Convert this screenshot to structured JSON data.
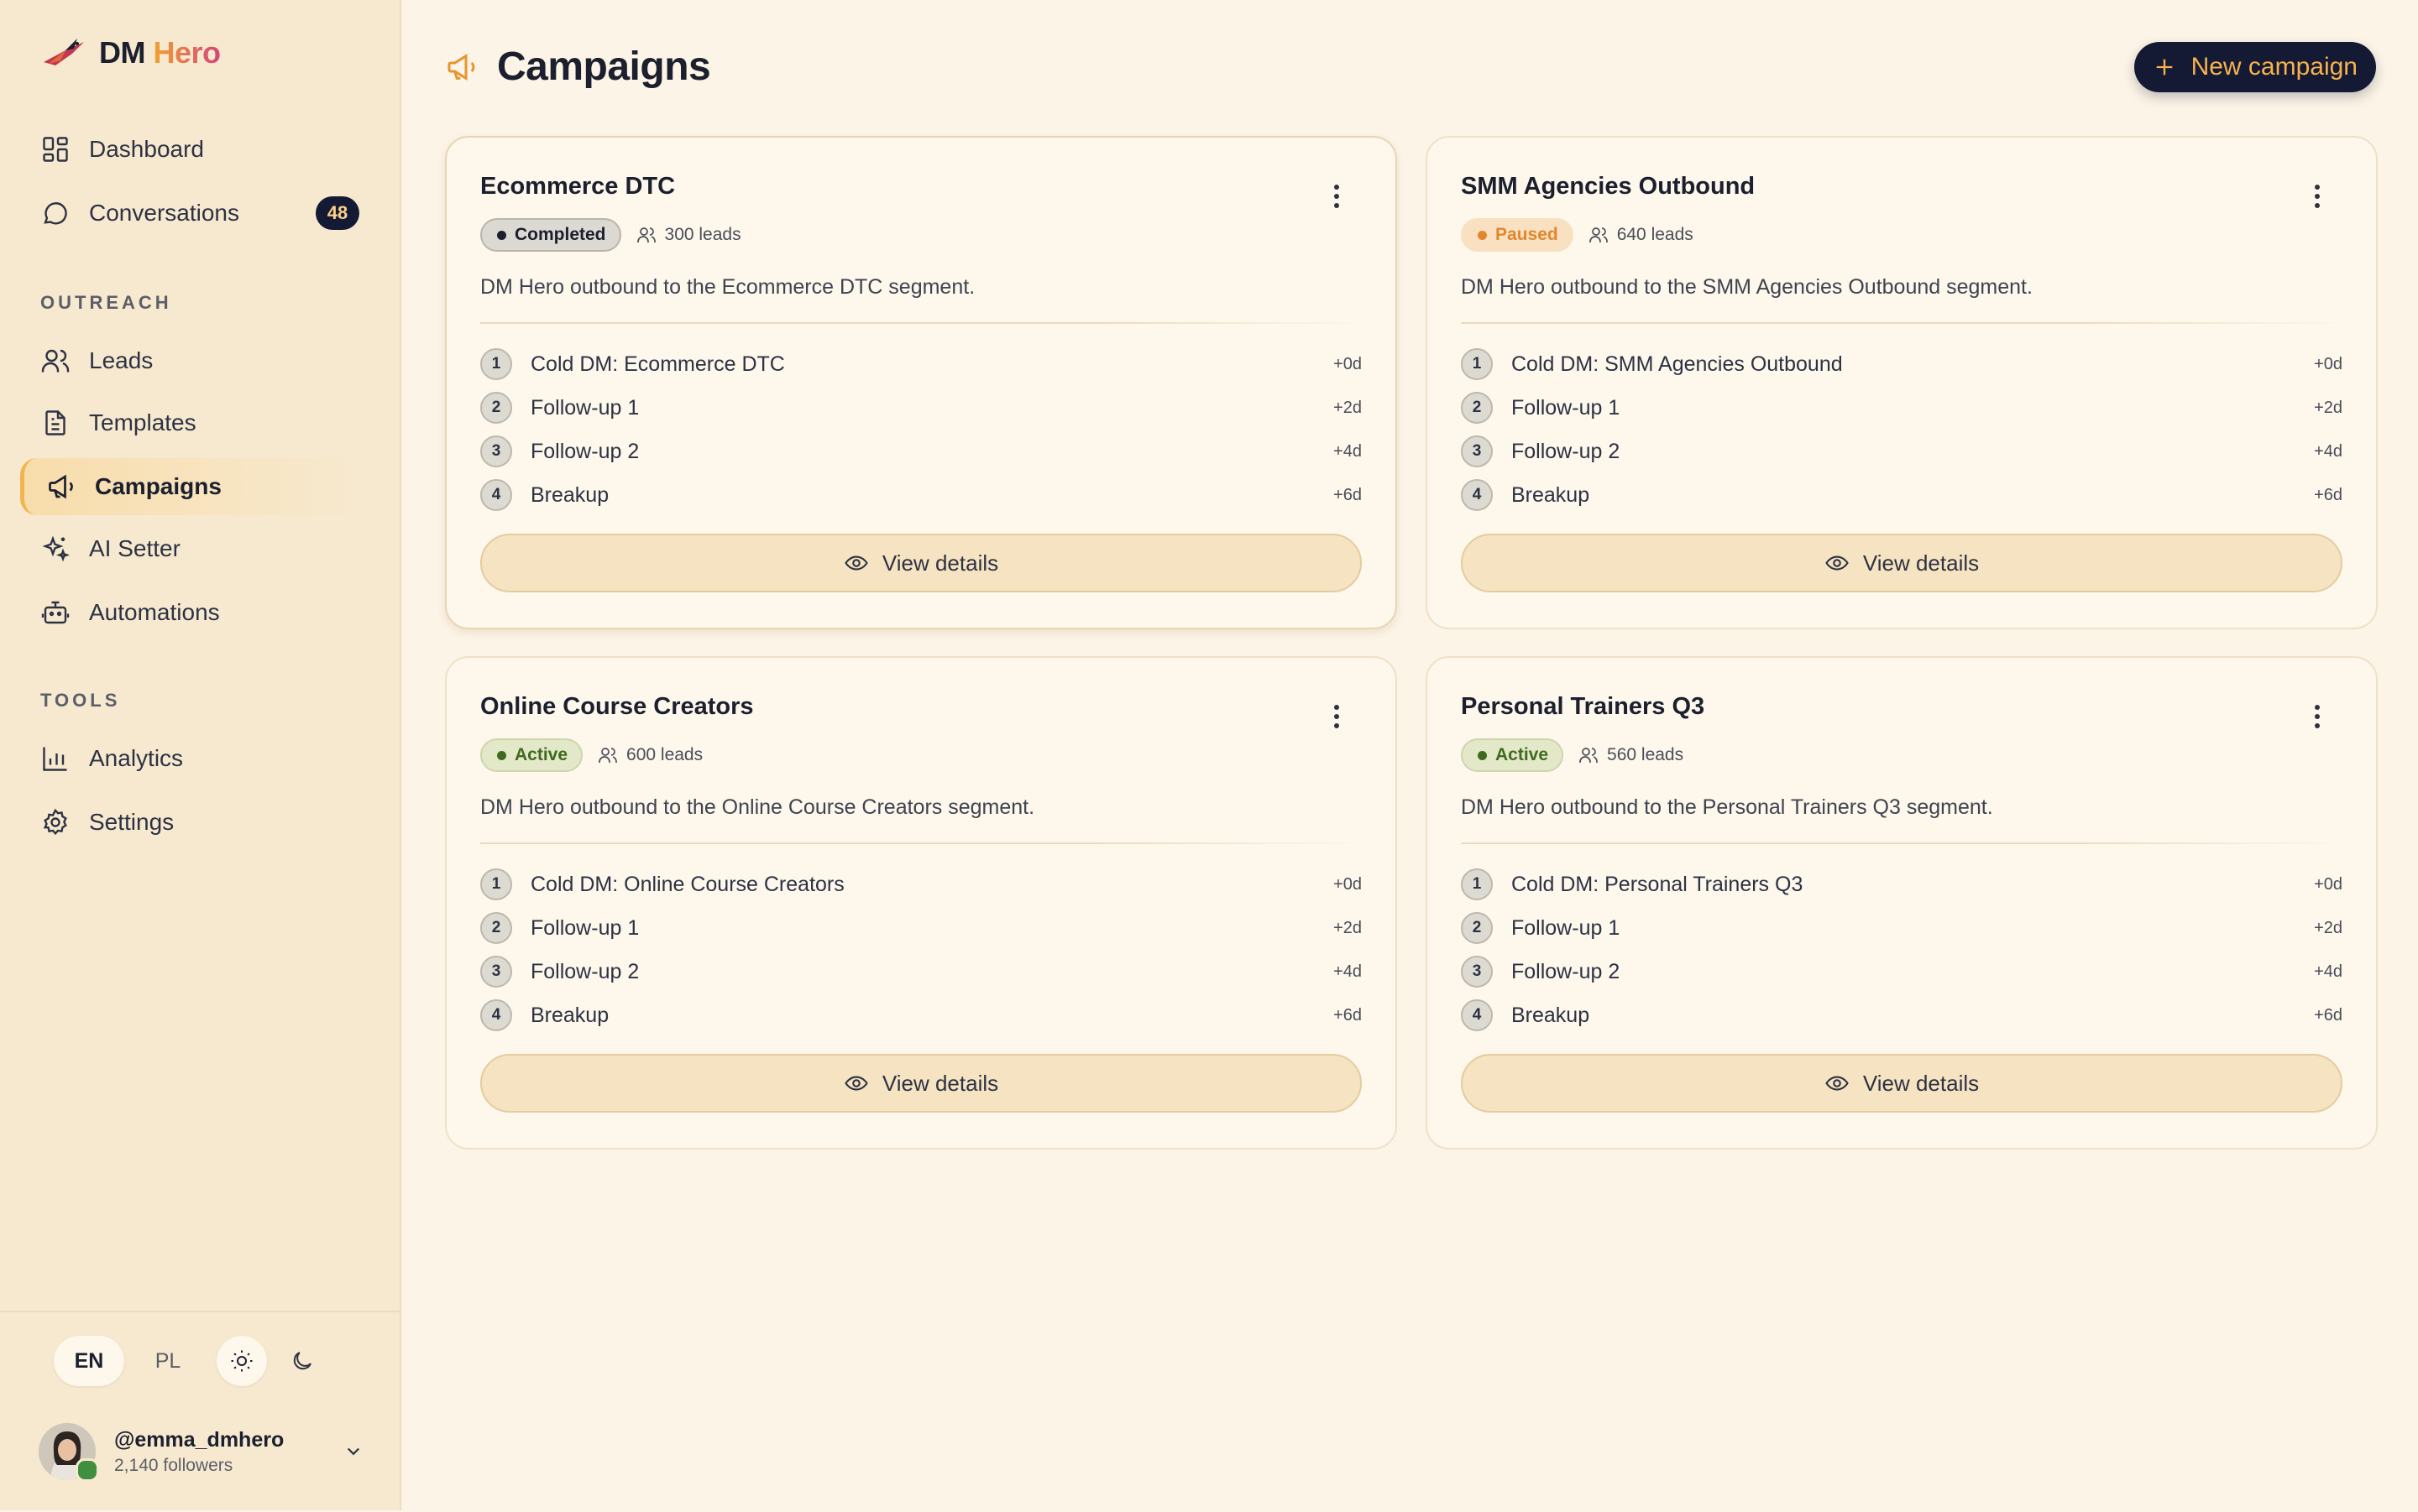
{
  "brand": {
    "name_main": "DM",
    "name_accent": "Hero"
  },
  "nav": {
    "dashboard": "Dashboard",
    "conversations": "Conversations",
    "conversations_badge": "48",
    "outreach_label": "OUTREACH",
    "leads": "Leads",
    "templates": "Templates",
    "campaigns": "Campaigns",
    "ai_setter": "AI Setter",
    "automations": "Automations",
    "tools_label": "TOOLS",
    "analytics": "Analytics",
    "settings": "Settings"
  },
  "footer": {
    "lang_en": "EN",
    "lang_pl": "PL",
    "user_handle": "@emma_dmhero",
    "user_followers": "2,140 followers"
  },
  "header": {
    "title": "Campaigns",
    "new_button": "New campaign"
  },
  "colors": {
    "accent": "#f7b24d",
    "navy": "#141a33",
    "completed_bg": "#dcd9d2",
    "paused_bg": "#f9e0c0",
    "paused_text": "#e0872e",
    "active_bg": "#e3e8c8",
    "active_text": "#3f6a1f"
  },
  "campaigns": [
    {
      "title": "Ecommerce DTC",
      "status": "Completed",
      "leads": "300 leads",
      "description": "DM Hero outbound to the Ecommerce DTC segment.",
      "steps": [
        {
          "num": "1",
          "name": "Cold DM: Ecommerce DTC",
          "delay": "+0d"
        },
        {
          "num": "2",
          "name": "Follow-up 1",
          "delay": "+2d"
        },
        {
          "num": "3",
          "name": "Follow-up 2",
          "delay": "+4d"
        },
        {
          "num": "4",
          "name": "Breakup",
          "delay": "+6d"
        }
      ],
      "view": "View details"
    },
    {
      "title": "SMM Agencies Outbound",
      "status": "Paused",
      "leads": "640 leads",
      "description": "DM Hero outbound to the SMM Agencies Outbound segment.",
      "steps": [
        {
          "num": "1",
          "name": "Cold DM: SMM Agencies Outbound",
          "delay": "+0d"
        },
        {
          "num": "2",
          "name": "Follow-up 1",
          "delay": "+2d"
        },
        {
          "num": "3",
          "name": "Follow-up 2",
          "delay": "+4d"
        },
        {
          "num": "4",
          "name": "Breakup",
          "delay": "+6d"
        }
      ],
      "view": "View details"
    },
    {
      "title": "Online Course Creators",
      "status": "Active",
      "leads": "600 leads",
      "description": "DM Hero outbound to the Online Course Creators segment.",
      "steps": [
        {
          "num": "1",
          "name": "Cold DM: Online Course Creators",
          "delay": "+0d"
        },
        {
          "num": "2",
          "name": "Follow-up 1",
          "delay": "+2d"
        },
        {
          "num": "3",
          "name": "Follow-up 2",
          "delay": "+4d"
        },
        {
          "num": "4",
          "name": "Breakup",
          "delay": "+6d"
        }
      ],
      "view": "View details"
    },
    {
      "title": "Personal Trainers Q3",
      "status": "Active",
      "leads": "560 leads",
      "description": "DM Hero outbound to the Personal Trainers Q3 segment.",
      "steps": [
        {
          "num": "1",
          "name": "Cold DM: Personal Trainers Q3",
          "delay": "+0d"
        },
        {
          "num": "2",
          "name": "Follow-up 1",
          "delay": "+2d"
        },
        {
          "num": "3",
          "name": "Follow-up 2",
          "delay": "+4d"
        },
        {
          "num": "4",
          "name": "Breakup",
          "delay": "+6d"
        }
      ],
      "view": "View details"
    }
  ]
}
